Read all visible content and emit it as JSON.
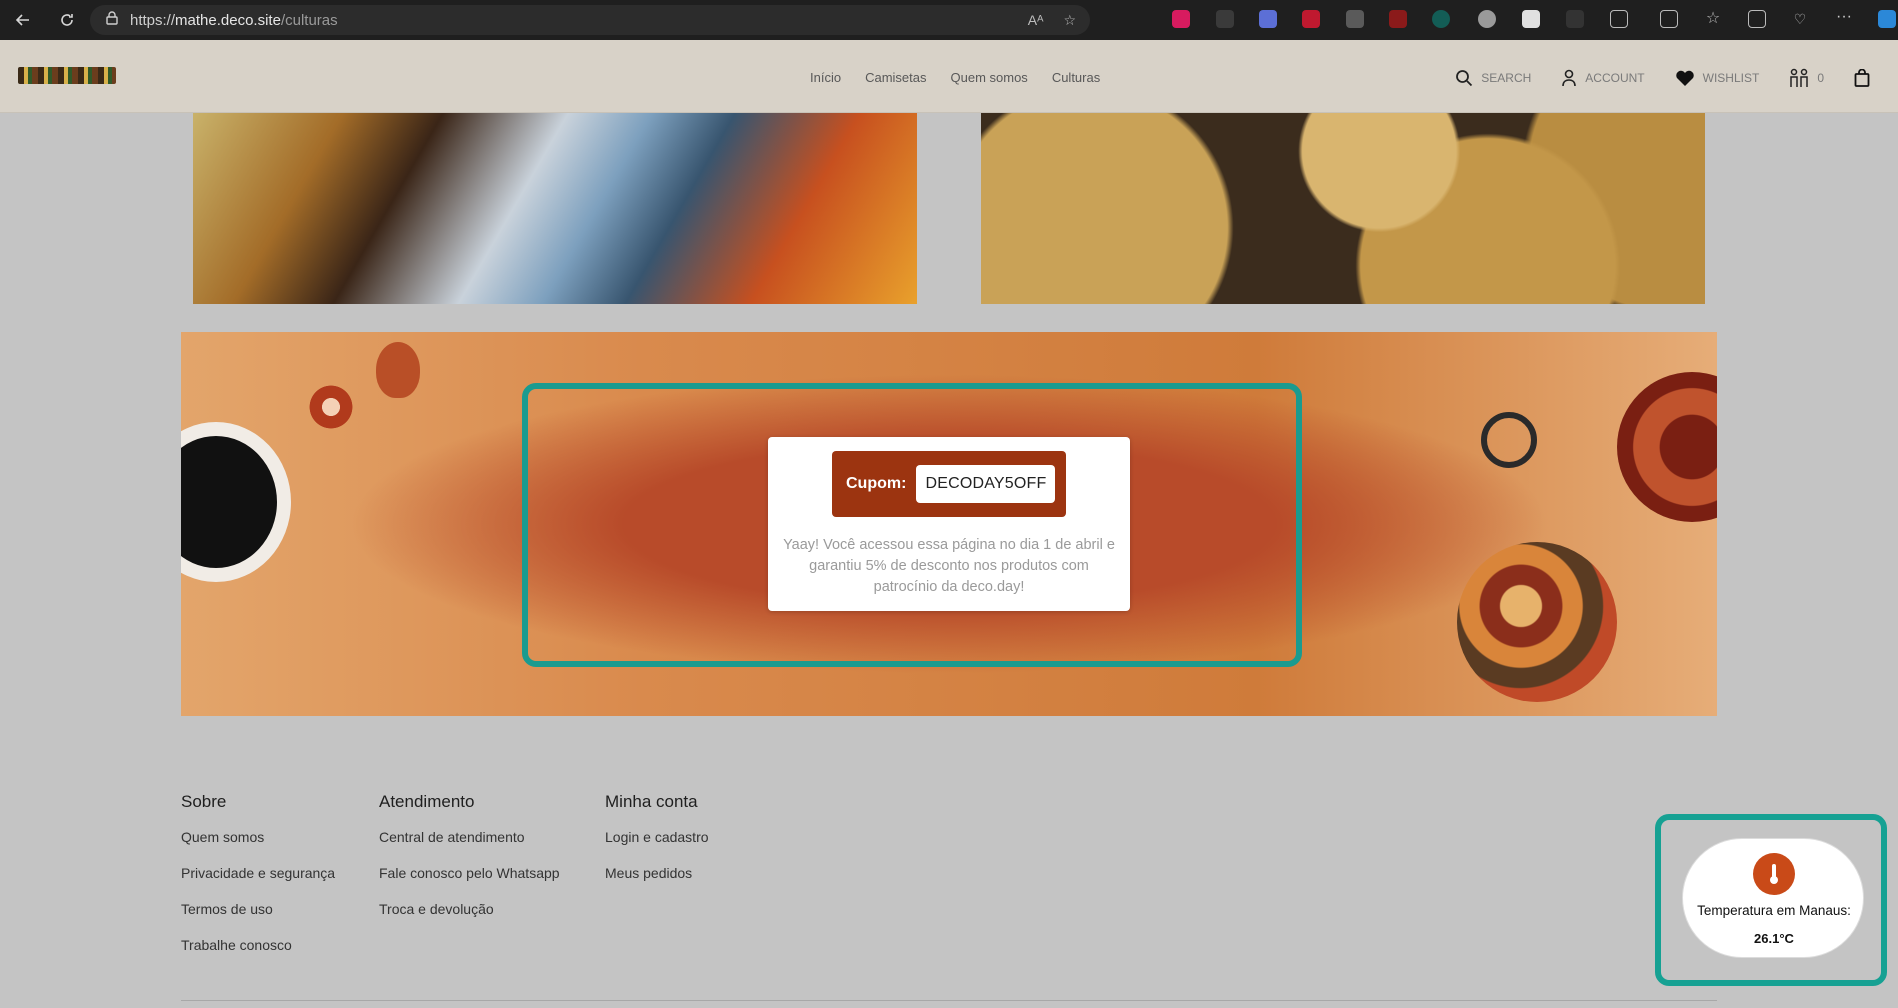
{
  "browser": {
    "url_scheme": "https://",
    "url_host": "mathe.deco.site",
    "url_path": "/culturas",
    "reader_label": "Aᴬ"
  },
  "header": {
    "logo_alt": "deco logo",
    "nav": [
      "Início",
      "Camisetas",
      "Quem somos",
      "Culturas"
    ],
    "search_label": "SEARCH",
    "account_label": "ACCOUNT",
    "wishlist_label": "WISHLIST",
    "compare_count": "0"
  },
  "promo": {
    "coupon_label": "Cupom:",
    "coupon_code": "DECODAY5OFF",
    "message": "Yaay! Você acessou essa página no dia 1 de abril e garantiu 5% de desconto nos produtos com patrocínio da deco.day!"
  },
  "footer": {
    "columns": [
      {
        "title": "Sobre",
        "links": [
          "Quem somos",
          "Privacidade e segurança",
          "Termos de uso",
          "Trabalhe conosco"
        ]
      },
      {
        "title": "Atendimento",
        "links": [
          "Central de atendimento",
          "Fale conosco pelo Whatsapp",
          "Troca e devolução"
        ]
      },
      {
        "title": "Minha conta",
        "links": [
          "Login e cadastro",
          "Meus pedidos"
        ]
      }
    ]
  },
  "weather": {
    "label": "Temperatura em Manaus:",
    "value": "26.1°C"
  },
  "colors": {
    "accent_frame": "#1a9b8f",
    "coupon_bg": "#9c3410",
    "thermo_bg": "#c94a18"
  }
}
